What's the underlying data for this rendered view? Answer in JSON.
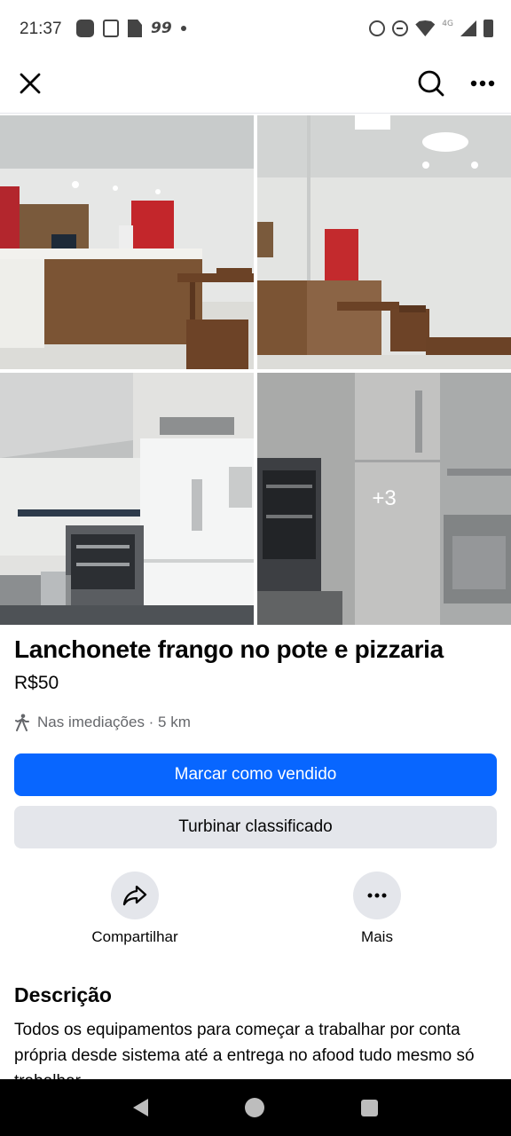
{
  "status_bar": {
    "time": "21:37",
    "notification_count": "99",
    "network_label": "4G",
    "icons": [
      "app-icon",
      "clipboard-icon",
      "doc-icon",
      "99-badge",
      "dot",
      "alarm-icon",
      "dnd-icon",
      "wifi-icon",
      "signal-icon",
      "battery-icon"
    ]
  },
  "top_nav": {
    "close_icon": "close-icon",
    "search_icon": "search-icon",
    "more_icon": "more-horizontal-icon"
  },
  "photos": {
    "extra_count": "+3"
  },
  "listing": {
    "title": "Lanchonete frango no pote e pizzaria",
    "price": "R$50",
    "location": "Nas imediações · 5 km"
  },
  "buttons": {
    "mark_sold": "Marcar como vendido",
    "boost": "Turbinar classificado"
  },
  "actions": {
    "share_label": "Compartilhar",
    "more_label": "Mais"
  },
  "description": {
    "heading": "Descrição",
    "text": "Todos os equipamentos para começar a trabalhar por conta própria desde sistema até a entrega no afood tudo mesmo só trabalhar"
  },
  "colors": {
    "primary": "#0866ff",
    "secondary_bg": "#e4e6eb",
    "muted_text": "#65676b"
  }
}
